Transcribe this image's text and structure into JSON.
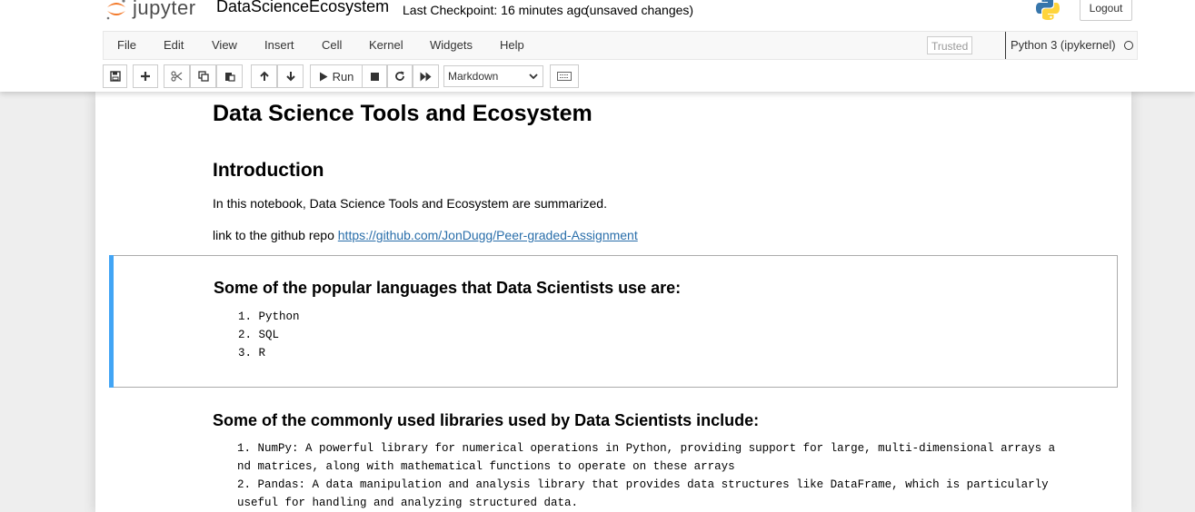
{
  "header": {
    "logo_text": "jupyter",
    "notebook_name": "DataScienceEcosystem",
    "checkpoint": "Last Checkpoint: 16 minutes ago",
    "autosave": "(unsaved changes)",
    "logout_label": "Logout"
  },
  "menubar": {
    "items": [
      "File",
      "Edit",
      "View",
      "Insert",
      "Cell",
      "Kernel",
      "Widgets",
      "Help"
    ],
    "trusted": "Trusted",
    "kernel": "Python 3 (ipykernel)"
  },
  "toolbar": {
    "run_label": "Run",
    "cell_type": "Markdown"
  },
  "notebook": {
    "title": "Data Science Tools and Ecosystem",
    "intro_heading": "Introduction",
    "intro_text": "In this notebook, Data Science Tools and Ecosystem are summarized.",
    "repo_prefix": "link to the github repo",
    "repo_url": "https://github.com/JonDugg/Peer-graded-Assignment",
    "languages_heading": "Some of the popular languages that Data Scientists use are:",
    "languages": [
      "1. Python",
      "2. SQL",
      "3. R"
    ],
    "libraries_heading": "Some of the commonly used libraries used by Data Scientists include:",
    "libraries": [
      "1. NumPy: A powerful library for numerical operations in Python, providing support for large, multi-dimensional arrays a",
      "nd matrices, along with mathematical functions to operate on these arrays",
      "2. Pandas: A data manipulation and analysis library that provides data structures like DataFrame, which is particularly",
      "useful for handling and analyzing structured data."
    ]
  },
  "colors": {
    "selected_cell_bar": "#42a5f5",
    "link": "#296eaa",
    "logo_orange": "#f37726"
  }
}
